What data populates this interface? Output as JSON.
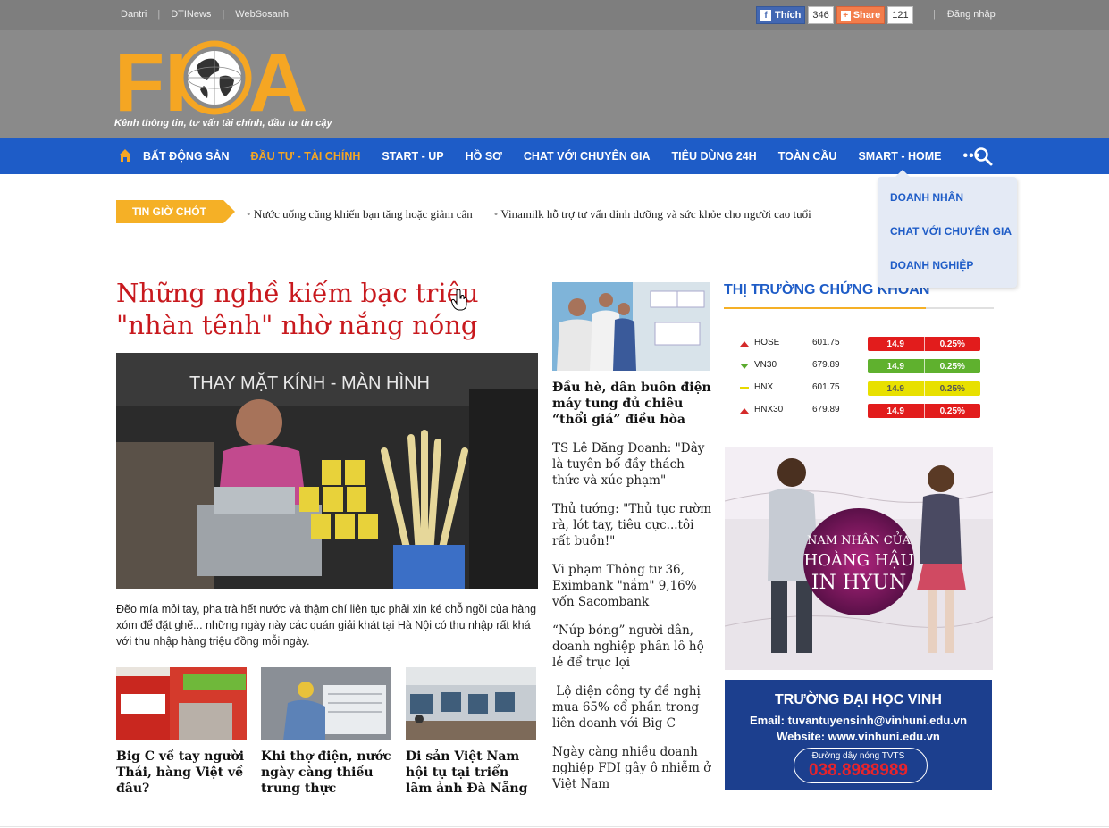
{
  "topbar": {
    "links": [
      "Dantri",
      "DTINews",
      "WebSosanh"
    ],
    "fb_like_label": "Thích",
    "fb_like_count": "346",
    "share_label": "Share",
    "share_count": "121",
    "login_label": "Đăng nhập"
  },
  "logo": {
    "tagline": "Kênh thông tin, tư vấn tài chính, đầu tư tin cậy"
  },
  "nav": {
    "items": [
      {
        "label": "BẤT ĐỘNG SẢN",
        "active": false
      },
      {
        "label": "ĐẦU TƯ - TÀI CHÍNH",
        "active": true
      },
      {
        "label": "START - UP",
        "active": false
      },
      {
        "label": "HỒ SƠ",
        "active": false
      },
      {
        "label": "CHAT VỚI CHUYÊN GIA",
        "active": false
      },
      {
        "label": "TIÊU DÙNG 24H",
        "active": false
      },
      {
        "label": "TOÀN CẦU",
        "active": false
      },
      {
        "label": "SMART - HOME",
        "active": false
      }
    ],
    "more_label": "•••",
    "dropdown": [
      "DOANH NHÂN",
      "CHAT VỚI CHUYÊN GIA",
      "DOANH NGHIỆP"
    ]
  },
  "ticker": {
    "label": "TIN GIỜ CHÓT",
    "items": [
      "Nước uống cũng khiến bạn tăng hoặc giảm cân",
      "Vinamilk hỗ trợ tư vấn dinh dưỡng và sức khỏe cho người cao tuổi"
    ]
  },
  "main_story": {
    "headline": "Những nghề kiếm bạc triệu \"nhàn tênh\" nhờ nắng nóng",
    "image_sign_text": "THAY MẶT KÍNH - MÀN HÌNH",
    "summary": "Đẽo mía mỏi tay, pha trà hết nước và thậm chí liên tục phải xin ké chỗ ngồi của hàng xóm để đặt ghế... những ngày này các quán giải khát tại Hà Nội có thu nhập rất khá với thu nhập hàng triệu đồng mỗi ngày."
  },
  "thumbs": [
    {
      "title": "Big C về tay người Thái, hàng Việt về đâu?"
    },
    {
      "title": "Khi thợ điện, nước ngày càng thiếu trung thực"
    },
    {
      "title": "Di sản Việt Nam hội tụ tại triển lãm ảnh Đà Nẵng"
    }
  ],
  "middle": {
    "featured_title": "Đầu hè, dân buôn điện máy tung đủ chiêu “thổi giá” điều hòa",
    "links": [
      "TS Lê Đăng Doanh: \"Đây là tuyên bố đầy thách thức và xúc phạm\"",
      "Thủ tướng: \"Thủ tục rườm rà, lót tay, tiêu cực...tôi rất buồn!\"",
      "Vi phạm Thông tư 36, Eximbank \"nắm\" 9,16% vốn Sacombank",
      "“Núp bóng” người dân, doanh nghiệp phân lô hộ lẻ để trục lợi",
      " Lộ diện công ty đề nghị mua 65% cổ phần trong liên doanh với Big C",
      "Ngày càng nhiều doanh nghiệp FDI gây ô nhiễm ở Việt Nam"
    ]
  },
  "stocks": {
    "title": "THỊ TRƯỜNG CHỨNG KHOÁN",
    "rows": [
      {
        "name": "HOSE",
        "value": "601.75",
        "change": "14.9",
        "pct": "0.25%",
        "trend": "up",
        "color": "#e21c1c"
      },
      {
        "name": "VN30",
        "value": "679.89",
        "change": "14.9",
        "pct": "0.25%",
        "trend": "down",
        "color": "#5fb12e"
      },
      {
        "name": "HNX",
        "value": "601.75",
        "change": "14.9",
        "pct": "0.25%",
        "trend": "flat",
        "color": "#e8e000"
      },
      {
        "name": "HNX30",
        "value": "679.89",
        "change": "14.9",
        "pct": "0.25%",
        "trend": "up",
        "color": "#e21c1c"
      }
    ]
  },
  "ads": {
    "movie_title_lines": [
      "NAM NHÂN CỦA",
      "HOÀNG HẬU",
      "IN HYUN"
    ],
    "university": {
      "name": "TRƯỜNG ĐẠI HỌC VINH",
      "email": "Email: tuvantuyensinh@vinhuni.edu.vn",
      "website": "Website: www.vinhuni.edu.vn",
      "hotline_label": "Đường dây nóng TVTS",
      "hotline": "038.8988989"
    }
  },
  "colors": {
    "brand_orange": "#f5a623",
    "nav_blue": "#1e5cc7",
    "headline_red": "#c8191e"
  }
}
